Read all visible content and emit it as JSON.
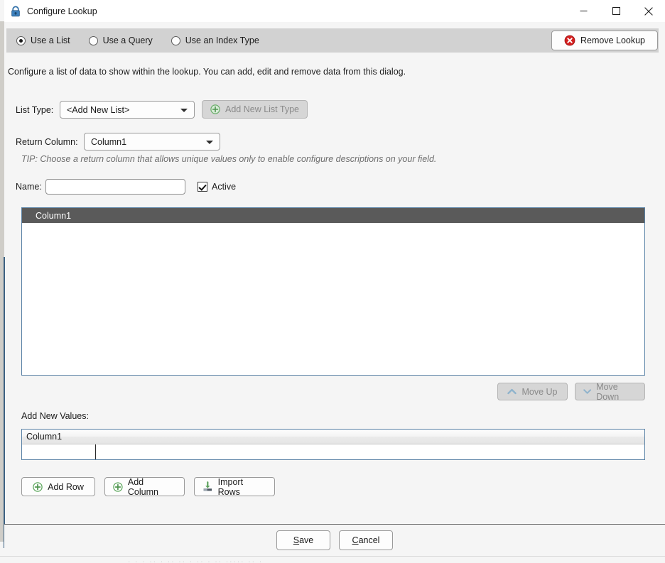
{
  "window": {
    "title": "Configure Lookup",
    "icon": "lock-icon",
    "caption": {
      "minimize": "minimize-icon",
      "maximize": "maximize-icon",
      "close": "close-icon"
    }
  },
  "mode_selector": {
    "options": [
      {
        "label": "Use a List",
        "selected": true
      },
      {
        "label": "Use a Query",
        "selected": false
      },
      {
        "label": "Use an Index Type",
        "selected": false
      }
    ]
  },
  "remove_lookup": {
    "label": "Remove Lookup",
    "icon": "error-circle-icon",
    "icon_color": "#d42020"
  },
  "description": "Configure a list of data to show within the lookup. You can add, edit and remove data from this dialog.",
  "list_type": {
    "label": "List Type:",
    "value": "<Add New List>",
    "add_button": {
      "label": "Add New List Type",
      "icon": "plus-circle-icon",
      "icon_color": "#5fa85f",
      "disabled": true
    }
  },
  "return_column": {
    "label": "Return Column:",
    "value": "Column1"
  },
  "tip": "TIP: Choose a return column that allows unique values only to enable configure descriptions on your field.",
  "name_field": {
    "label": "Name:",
    "value": "",
    "placeholder": ""
  },
  "active_checkbox": {
    "label": "Active",
    "checked": true
  },
  "list_view": {
    "columns": [
      "Column1"
    ],
    "rows": [],
    "header_bg": "#5a5a5a",
    "border_color": "#5a82a6"
  },
  "move_buttons": {
    "up": {
      "label": "Move Up",
      "icon": "chevron-up-icon",
      "disabled": true
    },
    "down": {
      "label": "Move Down",
      "icon": "chevron-down-icon",
      "disabled": true
    }
  },
  "add_new_values": {
    "label": "Add New Values:",
    "columns": [
      "Column1"
    ],
    "rows": [
      [
        "",
        ""
      ]
    ]
  },
  "grid_actions": [
    {
      "label": "Add Row",
      "icon": "plus-circle-icon"
    },
    {
      "label": "Add Column",
      "icon": "plus-circle-icon"
    },
    {
      "label": "Import Rows",
      "icon": "import-arrow-icon"
    }
  ],
  "footer": {
    "save": {
      "label": "Save",
      "accel": "S"
    },
    "cancel": {
      "label": "Cancel",
      "accel": "C"
    }
  }
}
